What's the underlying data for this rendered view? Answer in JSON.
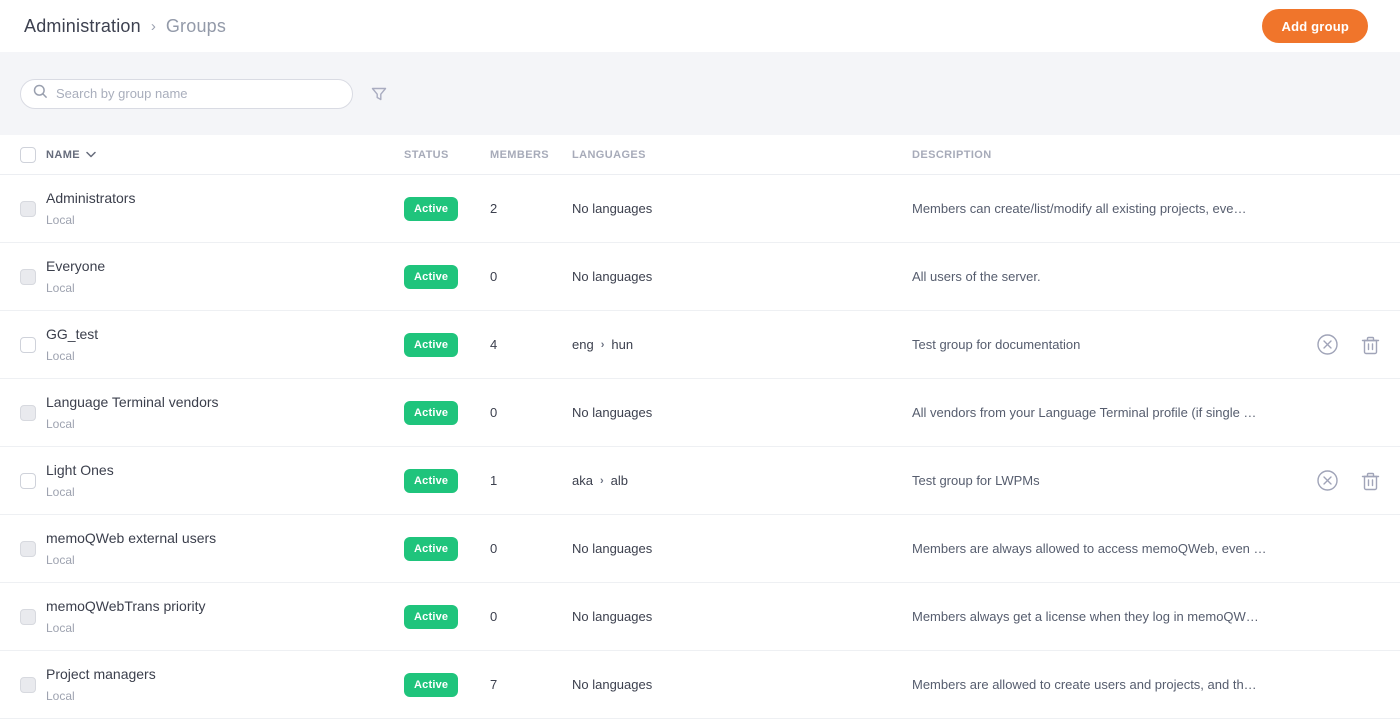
{
  "header": {
    "breadcrumb": {
      "section": "Administration",
      "separator": "›",
      "page": "Groups"
    },
    "add_group_label": "Add group"
  },
  "search": {
    "placeholder": "Search by group name"
  },
  "table": {
    "columns": {
      "name": "NAME",
      "status": "STATUS",
      "members": "MEMBERS",
      "languages": "LANGUAGES",
      "description": "DESCRIPTION"
    },
    "rows": [
      {
        "name": "Administrators",
        "type": "Local",
        "status": "Active",
        "members": "2",
        "languages": "No languages",
        "description": "Members can create/list/modify all existing projects, eve…"
      },
      {
        "name": "Everyone",
        "type": "Local",
        "status": "Active",
        "members": "0",
        "languages": "No languages",
        "description": "All users of the server."
      },
      {
        "name": "GG_test",
        "type": "Local",
        "status": "Active",
        "members": "4",
        "language_source": "eng",
        "language_target": "hun",
        "description": "Test group for documentation"
      },
      {
        "name": "Language Terminal vendors",
        "type": "Local",
        "status": "Active",
        "members": "0",
        "languages": "No languages",
        "description": "All vendors from your Language Terminal profile (if single …"
      },
      {
        "name": "Light Ones",
        "type": "Local",
        "status": "Active",
        "members": "1",
        "language_source": "aka",
        "language_target": "alb",
        "description": "Test group for LWPMs"
      },
      {
        "name": "memoQWeb external users",
        "type": "Local",
        "status": "Active",
        "members": "0",
        "languages": "No languages",
        "description": "Members are always allowed to access memoQWeb, even …"
      },
      {
        "name": "memoQWebTrans priority",
        "type": "Local",
        "status": "Active",
        "members": "0",
        "languages": "No languages",
        "description": "Members always get a license when they log in memoQW…"
      },
      {
        "name": "Project managers",
        "type": "Local",
        "status": "Active",
        "members": "7",
        "languages": "No languages",
        "description": "Members are allowed to create users and projects, and th…"
      }
    ]
  },
  "colors": {
    "accent_orange": "#f0752b",
    "status_green": "#1fc47c"
  }
}
